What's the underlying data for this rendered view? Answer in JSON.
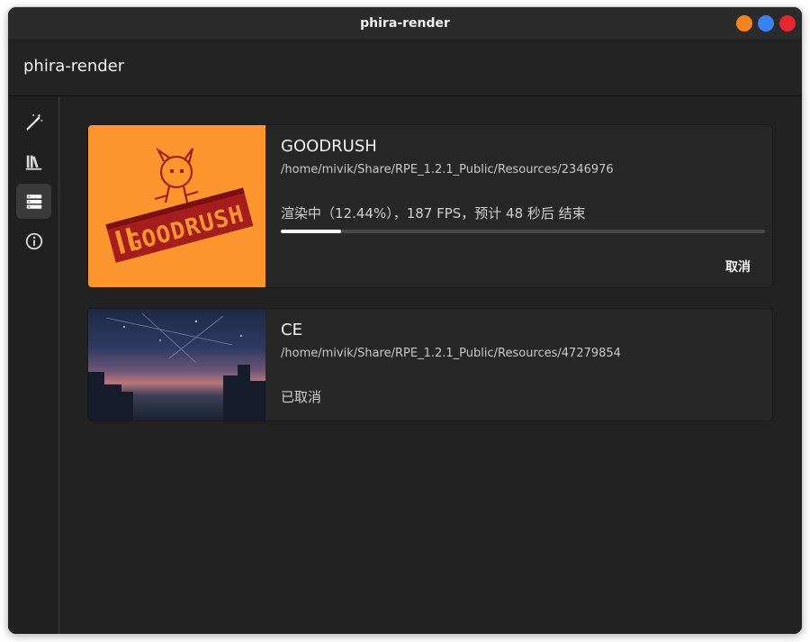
{
  "window": {
    "title": "phira-render",
    "controls": {
      "minimize_color": "#f7831f",
      "maximize_color": "#3b82f6",
      "close_color": "#e5272b"
    }
  },
  "header": {
    "app_title": "phira-render"
  },
  "sidebar": {
    "items": [
      {
        "icon": "magic-wand-icon",
        "active": false
      },
      {
        "icon": "library-icon",
        "active": false
      },
      {
        "icon": "render-queue-icon",
        "active": true
      },
      {
        "icon": "info-icon",
        "active": false
      }
    ]
  },
  "tasks": [
    {
      "name": "GOODRUSH",
      "path": "/home/mivik/Share/RPE_1.2.1_Public/Resources/2346976",
      "status": "渲染中（12.44%），187 FPS，预计 48 秒后 结束",
      "progress": 0.1244,
      "cancel_label": "取消",
      "thumbnail_text": "GOODRUSH",
      "thumbnail_color": "#fe962f"
    },
    {
      "name": "CE",
      "path": "/home/mivik/Share/RPE_1.2.1_Public/Resources/47279854",
      "status": "已取消"
    }
  ]
}
